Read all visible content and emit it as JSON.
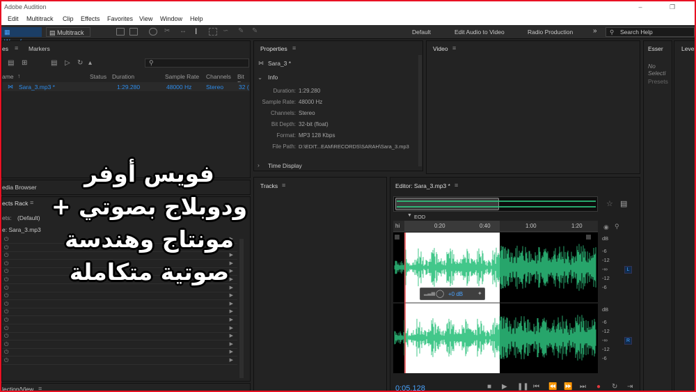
{
  "window": {
    "title": "Adobe Audition"
  },
  "menu": [
    "Edit",
    "Multitrack",
    "Clip",
    "Effects",
    "Favorites",
    "View",
    "Window",
    "Help"
  ],
  "toolbar": {
    "waveform": "Waveform",
    "multitrack": "Multitrack"
  },
  "workspaces": [
    "Default",
    "Edit Audio to Video",
    "Radio Production"
  ],
  "search": {
    "placeholder": "Search Help",
    "more": "»"
  },
  "files_panel": {
    "tabs": [
      "es",
      "Markers"
    ],
    "columns": [
      "ame",
      "Status",
      "Duration",
      "Sample Rate",
      "Channels",
      "Bit D"
    ],
    "row": {
      "name": "Sara_3.mp3 *",
      "status": "",
      "duration": "1:29.280",
      "rate": "48000 Hz",
      "channels": "Stereo",
      "bit": "32 ("
    }
  },
  "media_browser": {
    "tab": "edia Browser"
  },
  "effects_rack": {
    "tab": "ects Rack",
    "presets_label": "ets:",
    "preset_value": "(Default)",
    "file": "e: Sara_3.mp3"
  },
  "selection_view": {
    "tab": "lection/View"
  },
  "properties": {
    "title": "Properties",
    "file": "Sara_3 *",
    "info_header": "Info",
    "info": [
      {
        "label": "Duration:",
        "value": "1:29.280"
      },
      {
        "label": "Sample Rate:",
        "value": "48000 Hz"
      },
      {
        "label": "Channels:",
        "value": "Stereo"
      },
      {
        "label": "Bit Depth:",
        "value": "32-bit (float)"
      },
      {
        "label": "Format:",
        "value": "MP3 128 Kbps"
      },
      {
        "label": "File Path:",
        "value": "D:\\EDIT...EAM\\RECORDS\\SARAH\\Sara_3.mp3"
      }
    ],
    "time_display": "Time Display"
  },
  "video_panel": {
    "title": "Video"
  },
  "essential_panel": {
    "title": "Esser",
    "no_selection": "No Selecti",
    "presets": "Presets"
  },
  "levels_panel": {
    "title": "Levels"
  },
  "tracks_panel": {
    "title": "Tracks"
  },
  "editor": {
    "title": "Editor: Sara_3.mp3 *",
    "marker": "EOD",
    "ruler": [
      "hi",
      "0:20",
      "0:40",
      "1:00",
      "1:20"
    ],
    "db_labels_top": [
      "dB",
      "-6",
      "-12",
      "-∞",
      "-12",
      "-6"
    ],
    "db_labels_bottom": [
      "dB",
      "-6",
      "-12",
      "-∞",
      "-12",
      "-6"
    ],
    "channel_left": "L",
    "channel_right": "R",
    "hud_value": "+0 dB",
    "time": "0:05.128"
  },
  "overlay_text": [
    "فويس أوفر",
    "ودوبلاج بصوتي +",
    "مونتاج وهندسة",
    "صوتية متكاملة"
  ],
  "colors": {
    "accent": "#2d8ceb",
    "waveform": "#2ec27e",
    "selection": "#ffffff",
    "playhead": "#e0383d"
  }
}
